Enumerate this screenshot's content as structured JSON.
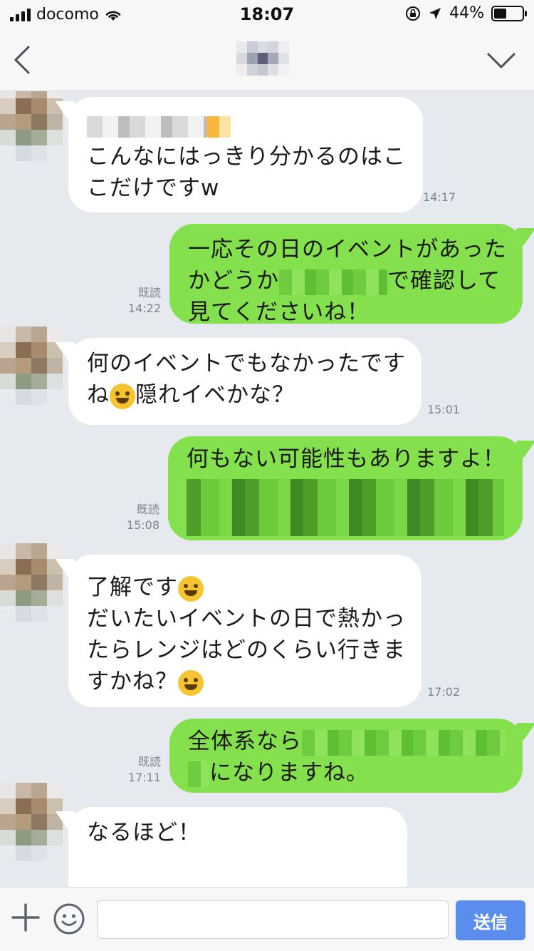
{
  "status_bar": {
    "carrier": "docomo",
    "time": "18:07",
    "battery_percent": "44%",
    "battery_level": 0.44
  },
  "header": {
    "back_icon": "chevron-left-icon",
    "menu_icon": "chevron-down-icon"
  },
  "messages": [
    {
      "side": "in",
      "lines": [
        "こんなにはっきり分かるのはこ",
        "こだけですw"
      ],
      "time": "14:17"
    },
    {
      "side": "out",
      "lines": [
        "一応その日のイベントがあった",
        "かどうか",
        "で確認して",
        "見てくださいね！"
      ],
      "read": "既読",
      "time": "14:22"
    },
    {
      "side": "in",
      "lines": [
        "何のイベントでもなかったです",
        "ね",
        "隠れイベかな？"
      ],
      "time": "15:01"
    },
    {
      "side": "out",
      "lines": [
        "何もない可能性もありますよ！"
      ],
      "read": "既読",
      "time": "15:08"
    },
    {
      "side": "in",
      "lines": [
        "了解です",
        "だいたいイベントの日で熱かっ",
        "たらレンジはどのくらい行きま",
        "すかね？"
      ],
      "time": "17:02"
    },
    {
      "side": "out",
      "lines": [
        "全体系なら",
        "になりますね。"
      ],
      "read": "既読",
      "time": "17:11"
    },
    {
      "side": "in",
      "lines": [
        "なるほど！"
      ]
    }
  ],
  "input_bar": {
    "plus_icon": "plus-icon",
    "emoji_icon": "smiley-icon",
    "placeholder": "",
    "send_label": "送信"
  },
  "colors": {
    "background": "#e6e9ee",
    "outgoing_bubble": "#84e04c",
    "incoming_bubble": "#ffffff",
    "send_button": "#5b8def"
  }
}
